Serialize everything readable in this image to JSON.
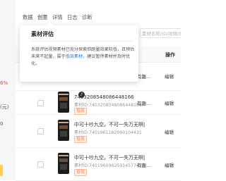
{
  "tabs": [
    {
      "label": "数据"
    },
    {
      "label": "创意"
    },
    {
      "label": "详情"
    },
    {
      "label": "日志"
    },
    {
      "label": "诊断"
    }
  ],
  "search": {
    "placeholder": "素材名称/ID/视频/抖音号"
  },
  "left_fragments": {
    "percent": "6%",
    "yuan": "(元)",
    "zero": "0"
  },
  "table": {
    "ops_header": "操作"
  },
  "popover": {
    "title": "素材评估",
    "body_line1": "系统评估视频素材已充分探索但跑量效果较低，且预估",
    "body_line2_pre": "未来不起量，属于",
    "body_line2_link": "低效素材",
    "body_line2_post": "，建议暂停素材并及时优",
    "body_line3": "化。",
    "tag": "低效"
  },
  "rows": [
    {
      "title": "",
      "sub": "",
      "tag": "",
      "trunc": "有趣...",
      "edit": "编辑"
    },
    {
      "title": "7403208548086448166",
      "sub": "素材ID:7403208548086448166",
      "tag": "低效",
      "trunc": "有趣...",
      "edit": "编辑"
    },
    {
      "title": "中可十吵九空，不可一失万无啊|",
      "sub": "素材ID:7401961162060104431",
      "tag": "低效",
      "trunc": "有趣...",
      "edit": "编辑"
    },
    {
      "title": "中可十吵九空，不可一失万无啊|",
      "sub": "素材ID:7401960962591457747",
      "tag": "低效",
      "trunc": "有趣...",
      "edit": "编辑"
    }
  ]
}
